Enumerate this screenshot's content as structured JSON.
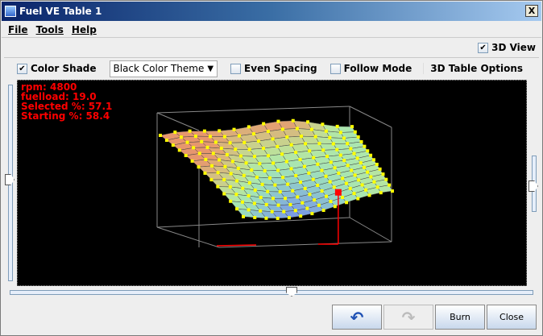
{
  "window": {
    "title": "Fuel VE Table 1",
    "close": "X"
  },
  "menu": [
    "File",
    "Tools",
    "Help"
  ],
  "view3d": {
    "label": "3D View",
    "checked": true
  },
  "options": {
    "color_shade": {
      "label": "Color Shade",
      "checked": true
    },
    "theme": {
      "value": "Black Color Theme",
      "arrow": "▼"
    },
    "even_spacing": {
      "label": "Even Spacing",
      "checked": false
    },
    "follow_mode": {
      "label": "Follow Mode",
      "checked": false
    },
    "table_options": "3D Table Options"
  },
  "info": {
    "rpm": "rpm: 4800",
    "fuelload": "fuelload: 19.0",
    "selected": "Selected %: 57.1",
    "starting": "Starting %: 58.4"
  },
  "buttons": {
    "undo": "undo-icon",
    "redo": "redo-icon",
    "burn": "Burn",
    "close": "Close"
  },
  "colors": {
    "marker": "#ffff00",
    "selected": "#ff0000",
    "background": "#000000"
  }
}
